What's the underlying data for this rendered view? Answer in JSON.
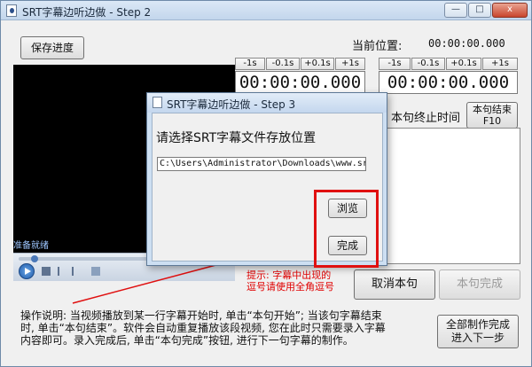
{
  "window": {
    "title": "SRT字幕边听边做 - Step 2",
    "min": "—",
    "max": "□",
    "close": "x"
  },
  "main": {
    "save_button": "保存进度",
    "current_position_label": "当前位置:",
    "current_position_value": "00:00:00.000",
    "steps": [
      "-1s",
      "-0.1s",
      "+0.1s",
      "+1s"
    ],
    "start_time": "00:00:00.000",
    "end_time": "00:00:00.000",
    "end_label": "本句终止时间",
    "end_button": {
      "line1": "本句结束",
      "line2": "F10"
    },
    "video_status": "准备就绪",
    "hint_lines": [
      "提示: 字幕中出现的",
      "逗号请使用全角逗号"
    ],
    "cancel_button": "取消本句",
    "complete_sentence_button": "本句完成",
    "finish_all_button": {
      "line1": "全部制作完成",
      "line2": "进入下一步"
    },
    "instructions": [
      "操作说明: 当视频播放到某一行字幕开始时, 单击“本句开始”; 当该句字幕结束",
      "时, 单击“本句结束”。软件会自动重复播放该段视频, 您在此时只需要录入字幕",
      "内容即可。录入完成后, 单击“本句完成”按钮, 进行下一句字幕的制作。"
    ]
  },
  "dialog": {
    "title": "SRT字幕边听边做 - Step 3",
    "prompt": "请选择SRT字幕文件存放位置",
    "path_value": "C:\\Users\\Administrator\\Downloads\\www.srt",
    "browse_button": "浏览",
    "done_button": "完成"
  },
  "colors": {
    "highlight": "#e01010",
    "hint": "#e00000"
  }
}
